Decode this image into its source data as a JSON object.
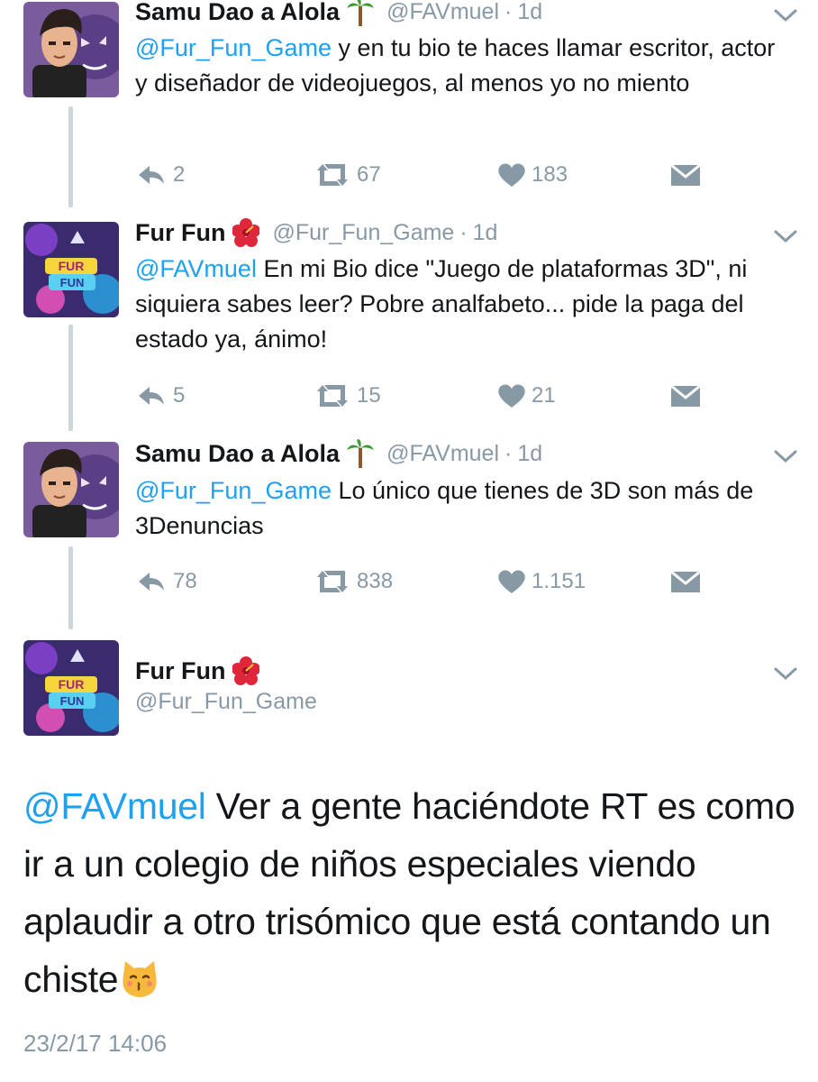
{
  "tweets": [
    {
      "name": "Samu Dao a Alola",
      "name_emoji": "palm-tree",
      "handle": "@FAVmuel",
      "time": "1d",
      "mention": "@Fur_Fun_Game",
      "text": " y en tu bio te haces llamar escritor, actor y diseñador de videojuegos, al menos yo no miento",
      "replies": "2",
      "retweets": "67",
      "likes": "183"
    },
    {
      "name": "Fur Fun",
      "name_emoji": "hibiscus",
      "handle": "@Fur_Fun_Game",
      "time": "1d",
      "mention": "@FAVmuel",
      "text": " En mi Bio dice \"Juego de plataformas 3D\", ni siquiera sabes leer? Pobre analfabeto... pide la paga del estado ya, ánimo!",
      "replies": "5",
      "retweets": "15",
      "likes": "21"
    },
    {
      "name": "Samu Dao a Alola",
      "name_emoji": "palm-tree",
      "handle": "@FAVmuel",
      "time": "1d",
      "mention": "@Fur_Fun_Game",
      "text": " Lo único que tienes de 3D son más de 3Denuncias",
      "replies": "78",
      "retweets": "838",
      "likes": "1.151"
    }
  ],
  "main_tweet": {
    "name": "Fur Fun",
    "name_emoji": "hibiscus",
    "handle": "@Fur_Fun_Game",
    "mention": "@FAVmuel",
    "text": " Ver a gente haciéndote RT es como ir a un colegio de niños especiales viendo aplaudir a otro trisómico que está contando un chiste",
    "trailing_emoji": "kissing-cat",
    "timestamp": "23/2/17 14:06"
  },
  "colors": {
    "link": "#1da1f2",
    "meta": "#8899a6",
    "thread_line": "#ccd6dd"
  }
}
